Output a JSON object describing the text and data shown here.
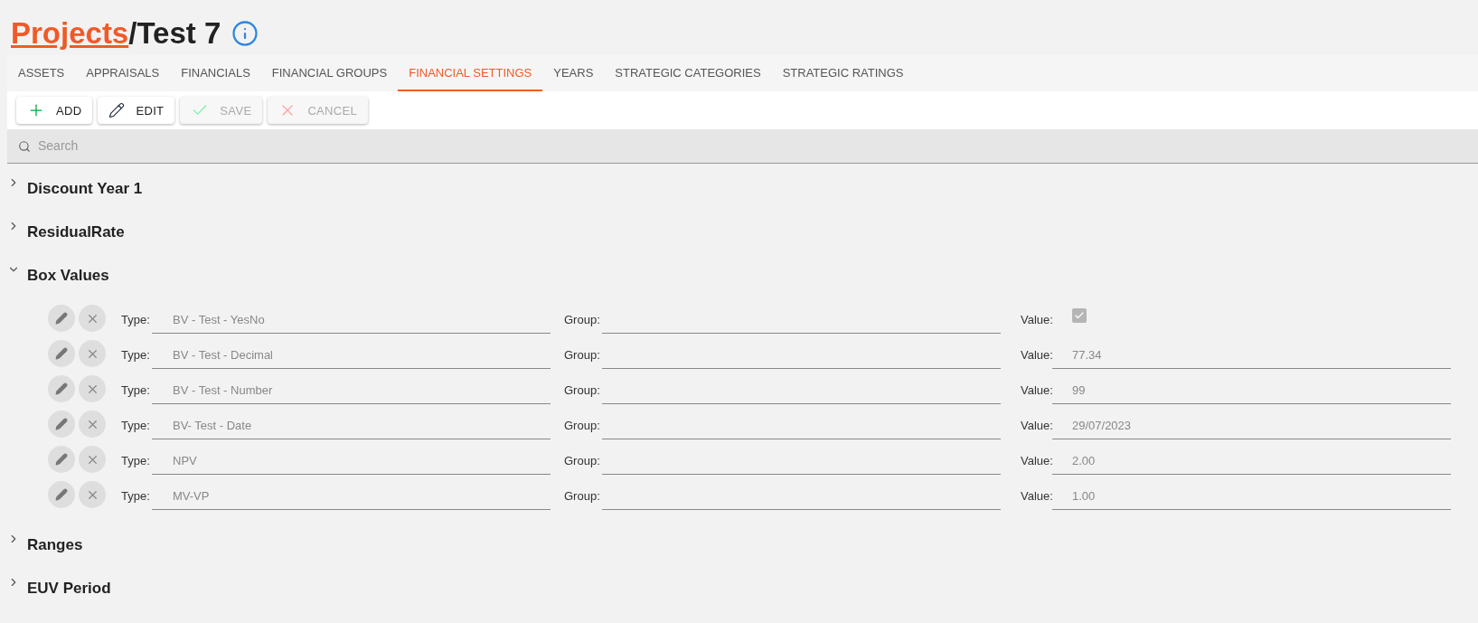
{
  "breadcrumb": {
    "link": "Projects",
    "separator": "/",
    "current": "Test 7"
  },
  "tabs": [
    {
      "label": "ASSETS",
      "selected": false
    },
    {
      "label": "APPRAISALS",
      "selected": false
    },
    {
      "label": "FINANCIALS",
      "selected": false
    },
    {
      "label": "FINANCIAL GROUPS",
      "selected": false
    },
    {
      "label": "FINANCIAL SETTINGS",
      "selected": true
    },
    {
      "label": "YEARS",
      "selected": false
    },
    {
      "label": "STRATEGIC CATEGORIES",
      "selected": false
    },
    {
      "label": "STRATEGIC RATINGS",
      "selected": false
    }
  ],
  "toolbar": [
    {
      "kind": "add",
      "label": "ADD",
      "disabled": false
    },
    {
      "kind": "edit",
      "label": "EDIT",
      "disabled": false
    },
    {
      "kind": "save",
      "label": "SAVE",
      "disabled": true
    },
    {
      "kind": "cancel",
      "label": "CANCEL",
      "disabled": true
    }
  ],
  "search": {
    "placeholder": "Search"
  },
  "sections": [
    {
      "title": "Discount Year 1",
      "expanded": false
    },
    {
      "title": "ResidualRate",
      "expanded": false
    },
    {
      "title": "Box Values",
      "expanded": true,
      "rows": [
        {
          "type_label": "Type:",
          "type": "BV - Test - YesNo",
          "group_label": "Group:",
          "value_label": "Value:",
          "kind": "checkbox",
          "checked": true
        },
        {
          "type_label": "Type:",
          "type": "BV - Test - Decimal",
          "group_label": "Group:",
          "value_label": "Value:",
          "kind": "text",
          "value": "77.34"
        },
        {
          "type_label": "Type:",
          "type": "BV - Test -  Number",
          "group_label": "Group:",
          "value_label": "Value:",
          "kind": "text",
          "value": "99"
        },
        {
          "type_label": "Type:",
          "type": "BV- Test - Date",
          "group_label": "Group:",
          "value_label": "Value:",
          "kind": "text",
          "value": "29/07/2023"
        },
        {
          "type_label": "Type:",
          "type": "NPV",
          "group_label": "Group:",
          "value_label": "Value:",
          "kind": "text",
          "value": "2.00"
        },
        {
          "type_label": "Type:",
          "type": "MV-VP",
          "group_label": "Group:",
          "value_label": "Value:",
          "kind": "text",
          "value": "1.00"
        }
      ]
    },
    {
      "title": "Ranges",
      "expanded": false
    },
    {
      "title": "EUV Period",
      "expanded": false
    }
  ]
}
